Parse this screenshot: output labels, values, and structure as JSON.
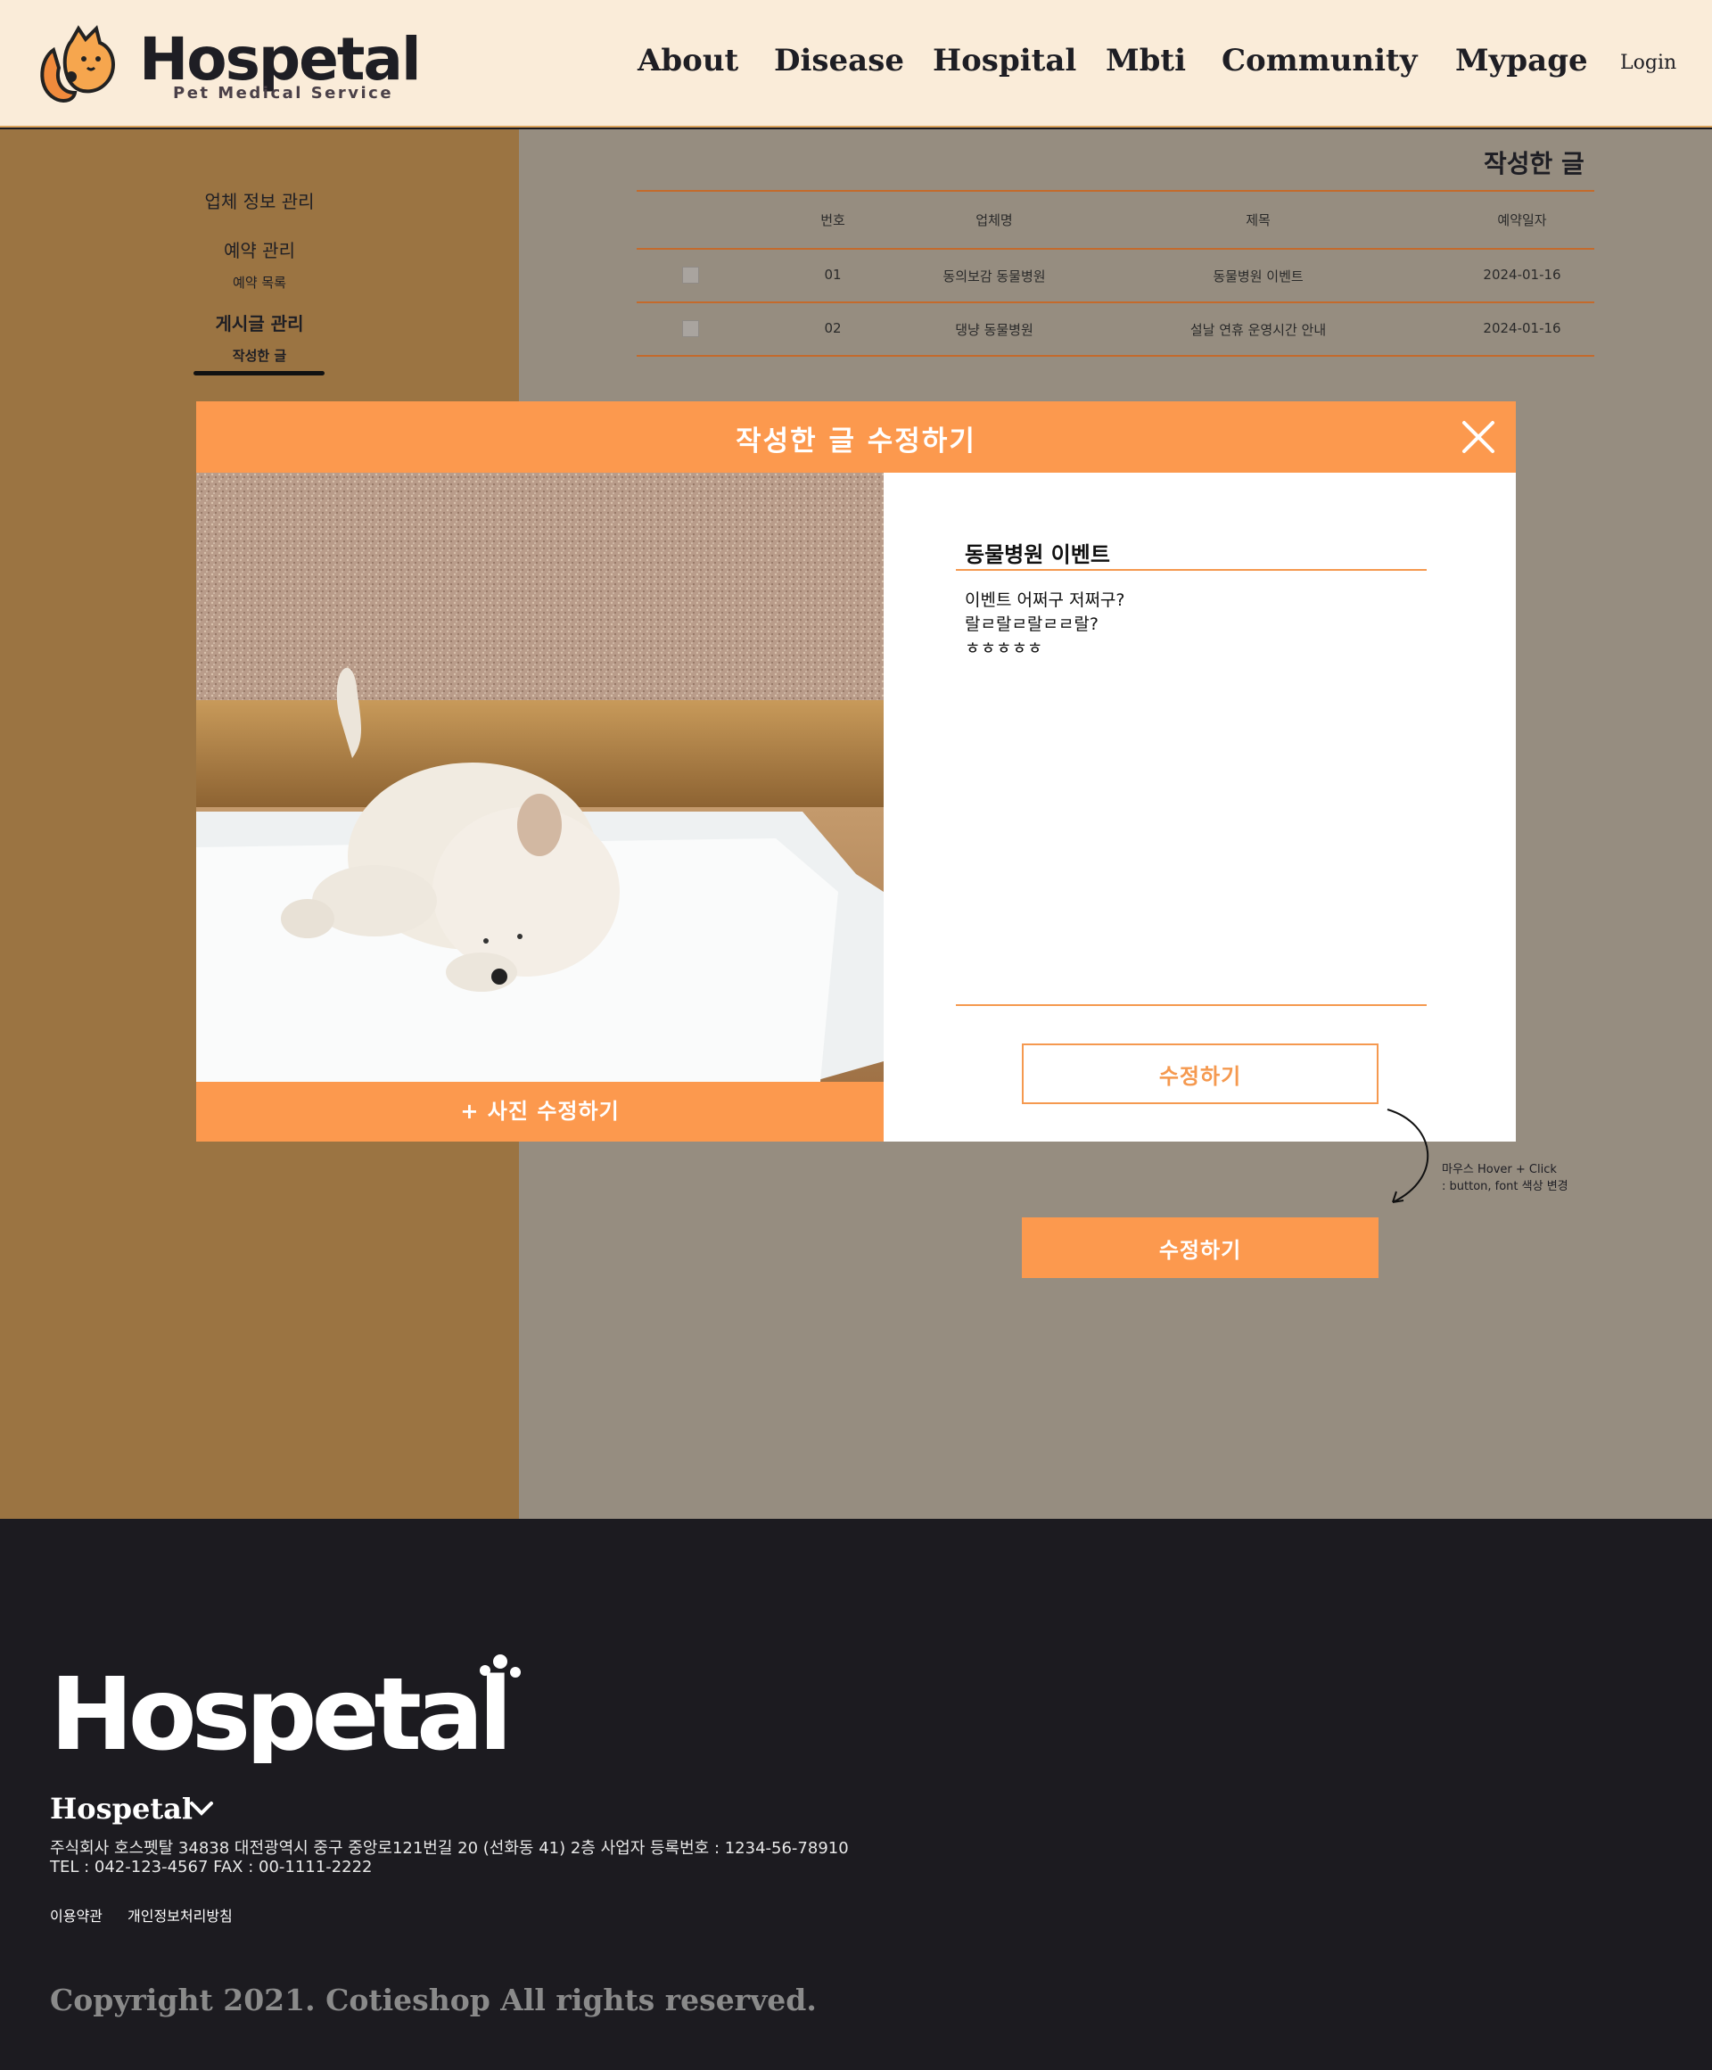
{
  "header": {
    "logo_text": "Hospetal",
    "logo_subtitle": "Pet Medical Service",
    "nav": [
      "About",
      "Disease",
      "Hospital",
      "Mbti",
      "Community",
      "Mypage"
    ],
    "login": "Login"
  },
  "sidebar": {
    "business_info": "업체 정보 관리",
    "reservation_manage": "예약 관리",
    "reservation_list": "예약 목록",
    "post_manage": "게시글 관리",
    "my_posts": "작성한 글"
  },
  "main": {
    "title": "작성한 글",
    "columns": [
      "번호",
      "업체명",
      "제목",
      "예약일자"
    ],
    "rows": [
      {
        "no": "01",
        "company": "동의보감 동물병원",
        "subject": "동물병원 이벤트",
        "date": "2024-01-16"
      },
      {
        "no": "02",
        "company": "댕냥 동물병원",
        "subject": "설날 연휴 운영시간 안내",
        "date": "2024-01-16"
      }
    ]
  },
  "modal": {
    "title": "작성한 글 수정하기",
    "photo_button": "+ 사진 수정하기",
    "post_title": "동물병원 이벤트",
    "post_body": "이벤트 어쩌구 저쩌구?\n랄ㄹ랄ㄹ랄ㄹㄹ랄?\nㅎㅎㅎㅎㅎ",
    "submit": "수정하기"
  },
  "hover_demo": {
    "button": "수정하기",
    "note_line1": "마우스 Hover + Click",
    "note_line2": ": button, font 색상 변경"
  },
  "footer": {
    "logo_text": "Hospetal",
    "name": "Hospetal",
    "address": "주식회사 호스펫탈 34838 대전광역시 중구 중앙로121번길 20 (선화동 41) 2층  사업자 등록번호 : 1234-56-78910",
    "contact": "TEL : 042-123-4567 FAX : 00-1111-2222",
    "terms": "이용약관",
    "privacy": "개인정보처리방침",
    "copyright": "Copyright 2021. Cotieshop All rights reserved."
  },
  "colors": {
    "header_bg": "#faecd9",
    "sidebar_bg": "#9b7442",
    "main_bg": "#968d80",
    "accent": "#fc994e",
    "footer_bg": "#1c1b20"
  },
  "icons": [
    "cat-dog-logo-icon",
    "close-icon",
    "chevron-down-icon",
    "curved-arrow-icon"
  ]
}
